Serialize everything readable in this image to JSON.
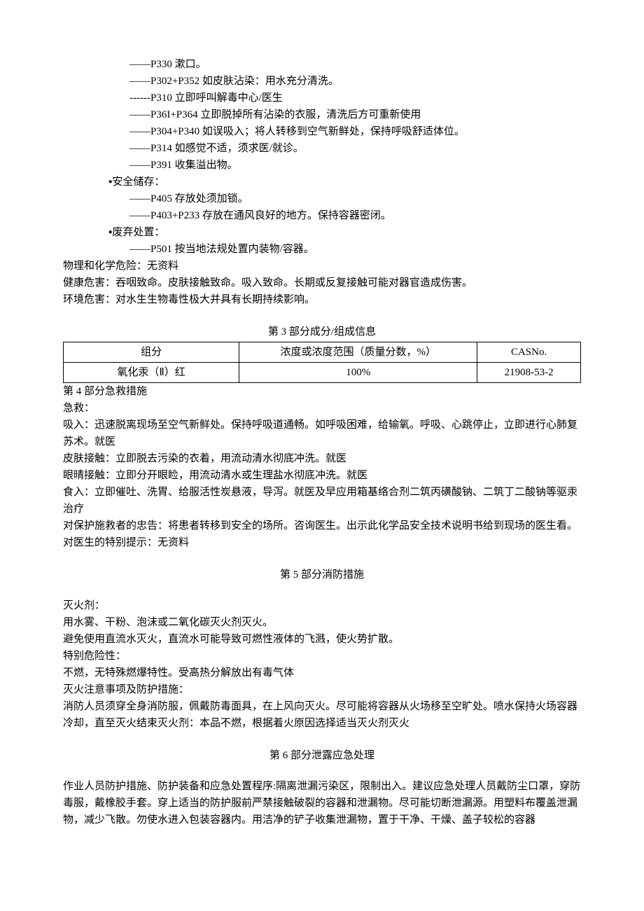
{
  "intro": {
    "lines": [
      "——P330 漱口。",
      "——P302+P352 如皮肤沾染：用水充分清洗。",
      "------P310 立即呼叫解毒中心/医生",
      "——P36I+P364 立即脱掉所有沾染的衣服，清洗后方可重新使用",
      "——P304+P340 如误吸入；将人转移到空气新鲜处，保持呼吸舒适体位。",
      "——P314 如感觉不适，须求医/就诊。",
      "——P391 收集溢出物。"
    ],
    "storage_label": "▪安全储存：",
    "storage_lines": [
      "——P405 存放处须加锁。",
      "——P403+P233 存放在通风良好的地方。保持容器密闭。"
    ],
    "disposal_label": "▪废弃处置：",
    "disposal_lines": [
      "——P501 按当地法规处置内装物/容器。"
    ],
    "phys_chem": "物理和化学危险：无资料",
    "health": "健康危害：吞咽致命。皮肤接触致命。吸入致命。长期或反复接触可能对器官造成伤害。",
    "env": "环境危害：对水生生物毒性极大并具有长期持续影响。"
  },
  "section3": {
    "title": "第 3 部分成分/组成信息",
    "headers": [
      "组分",
      "浓度或浓度范围（质量分数，%）",
      "CASNo."
    ],
    "row": [
      "氧化汞（Ⅱ）红",
      "100%",
      "21908-53-2"
    ]
  },
  "section4": {
    "title": "第 4 部分急救措施",
    "lines": [
      "急救：",
      "吸入：迅速脱离现场至空气新鲜处。保持呼吸道通畅。如呼吸困难，给输氧。呼吸、心跳停止，立即进行心肺复苏术。就医",
      "皮肤接触：立即脱去污染的衣着，用流动清水彻底冲洗。就医",
      "眼晴接触：立即分开眼睑，用流动清水或生理盐水彻底冲洗。就医",
      "食入：立即催吐、洗胃、给服活性炭悬液，导泻。就医及早应用箱基络合剂二筑丙磺酸钠、二筑丁二酸钠等驱汞治疗",
      "对保护施救者的忠告：将患者转移到安全的场所。咨询医生。出示此化学品安全技术说明书给到现场的医生看。",
      "对医生的特别提示：无资料"
    ]
  },
  "section5": {
    "title": "第 5 部分消防措施",
    "lines": [
      "灭火剂：",
      "用水雾、干粉、泡沫或二氧化碳灭火剂灭火。",
      "避免使用直流水灭火，直流水可能导致可燃性液体的飞溅，使火势扩散。",
      "特别危险性：",
      "不燃，无特殊燃爆特性。受高热分解放出有毒气体",
      "灭火注意事项及防护措施：",
      "消防人员须穿全身消防服，佩戴防毒面具，在上风向灭火。尽可能将容器从火场移至空旷处。喷水保持火场容器冷却，直至灭火结束灭火剂：本品不燃，根据着火原因选择适当灭火剂灭火"
    ]
  },
  "section6": {
    "title": "第 6 部分泄露应急处理",
    "lines": [
      "作业人员防护措施、防护装备和应急处置程序:隔离泄漏污染区，限制出入。建议应急处理人员戴防尘口罩，穿防毒服，戴橡胶手套。穿上适当的防护服前严禁接触破裂的容器和泄漏物。尽可能切断泄漏源。用塑料布覆盖泄漏物，减少飞散。勿使水进入包装容器内。用洁净的铲子收集泄漏物，置于干净、干燥、盖子较松的容器"
    ]
  }
}
